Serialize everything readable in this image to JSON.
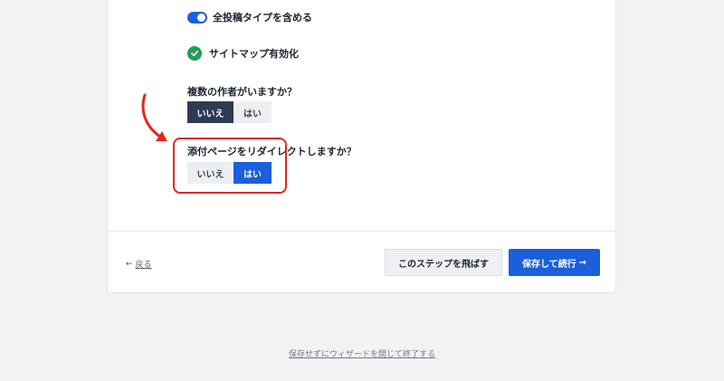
{
  "options": {
    "include_all_post_types": "全投稿タイプを含める",
    "include_all_post_types_enabled": true,
    "sitemap_enabled": "サイトマップ有効化"
  },
  "multiple_authors": {
    "question": "複数の作者がいますか？",
    "no_label": "いいえ",
    "yes_label": "はい",
    "selected": "いいえ"
  },
  "redirect_attachments": {
    "question": "添付ページをリダイレクトしますか？",
    "no_label": "いいえ",
    "yes_label": "はい",
    "selected": "はい"
  },
  "footer": {
    "back_arrow": "←",
    "back_label": "戻る",
    "skip_label": "このステップを飛ばす",
    "save_label": "保存して続行",
    "save_arrow": "→"
  },
  "exit_link": "保存せずにウィザードを閉じて終了する",
  "colors": {
    "primary": "#1a5fdb",
    "selected_dark": "#2f3a58",
    "success": "#1e9e57",
    "annotation": "#e02a1e"
  },
  "icons": {
    "toggle": "toggle-on-icon",
    "check": "check-circle-icon",
    "annotation_arrow": "red-curved-arrow-icon"
  }
}
